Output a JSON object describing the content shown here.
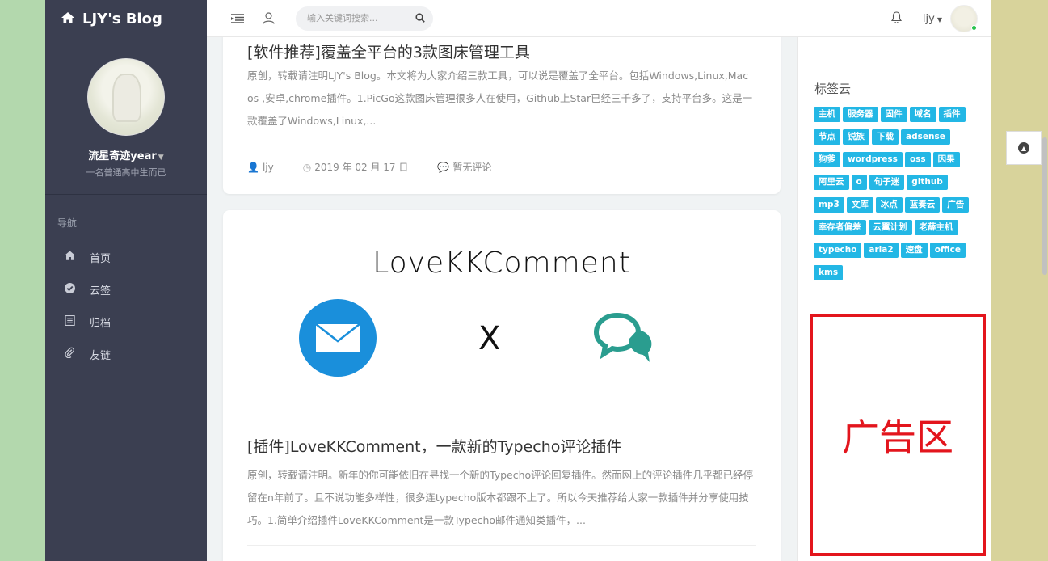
{
  "brand": {
    "title": "LJY's Blog"
  },
  "profile": {
    "name": "流星奇迹year",
    "subtitle": "一名普通高中生而已"
  },
  "nav": {
    "header": "导航",
    "items": [
      {
        "label": "首页",
        "icon": "home-icon"
      },
      {
        "label": "云签",
        "icon": "check-circle-icon"
      },
      {
        "label": "归档",
        "icon": "list-icon"
      },
      {
        "label": "友链",
        "icon": "paperclip-icon"
      }
    ]
  },
  "topbar": {
    "search_placeholder": "输入关键词搜索...",
    "username": "ljy"
  },
  "posts": [
    {
      "title": "[软件推荐]覆盖全平台的3款图床管理工具",
      "excerpt": "原创，转载请注明LJY's Blog。本文将为大家介绍三款工具，可以说是覆盖了全平台。包括Windows,Linux,Mac os ,安卓,chrome插件。1.PicGo这款图床管理很多人在使用，Github上Star已经三千多了，支持平台多。这是一款覆盖了Windows,Linux,...",
      "author": "ljy",
      "date": "2019 年 02 月 17 日",
      "comments": "暂无评论"
    },
    {
      "cover_title": "LoveKKComment",
      "cover_cross": "X",
      "title": "[插件]LoveKKComment，一款新的Typecho评论插件",
      "excerpt": "原创，转载请注明。新年的你可能依旧在寻找一个新的Typecho评论回复插件。然而网上的评论插件几乎都已经停留在n年前了。且不说功能多样性，很多连typecho版本都跟不上了。所以今天推荐给大家一款插件并分享使用技巧。1.简单介绍插件LoveKKComment是一款Typecho邮件通知类插件，..."
    }
  ],
  "tag_cloud": {
    "title": "标签云",
    "tags": [
      "主机",
      "服务器",
      "固件",
      "域名",
      "插件",
      "节点",
      "锐族",
      "下载",
      "adsense",
      "狗爹",
      "wordpress",
      "oss",
      "因果",
      "阿里云",
      "o",
      "句子迷",
      "github",
      "mp3",
      "文库",
      "冰点",
      "蓝奏云",
      "广告",
      "幸存者偏差",
      "云翼计划",
      "老薛主机",
      "typecho",
      "aria2",
      "速盘",
      "office",
      "kms"
    ]
  },
  "ad": {
    "label": "广告区"
  },
  "colors": {
    "sidebar": "#3b3f51",
    "tag": "#23b7e5",
    "ad_border": "#e3151d",
    "mail": "#1a8fdb",
    "chat": "#2a9d8f"
  }
}
